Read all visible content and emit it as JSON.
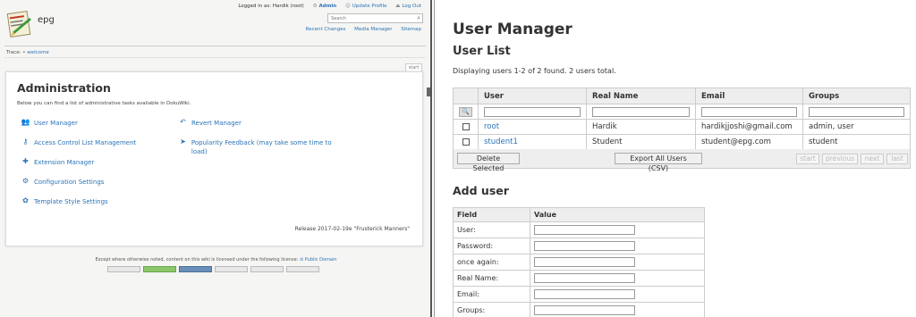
{
  "left": {
    "site_title": "epg",
    "user_line": {
      "logged_in": "Logged in as: Hardik (root)",
      "admin": "Admin",
      "update_profile": "Update Profile",
      "log_out": "Log Out"
    },
    "search_placeholder": "Search",
    "tools": {
      "recent_changes": "Recent Changes",
      "media_manager": "Media Manager",
      "sitemap": "Sitemap"
    },
    "trace_label": "Trace:",
    "trace_link": "welcome",
    "start_tab": "start",
    "admin": {
      "title": "Administration",
      "description": "Below you can find a list of administrative tasks available in DokuWiki.",
      "items_left": [
        {
          "label": "User Manager",
          "icon": "users-icon"
        },
        {
          "label": "Access Control List Management",
          "icon": "key-icon"
        },
        {
          "label": "Extension Manager",
          "icon": "puzzle-icon"
        },
        {
          "label": "Configuration Settings",
          "icon": "gear-icon"
        },
        {
          "label": "Template Style Settings",
          "icon": "palette-icon"
        }
      ],
      "items_right": [
        {
          "label": "Revert Manager",
          "icon": "revert-icon"
        },
        {
          "label": "Popularity Feedback (may take some time to load)",
          "icon": "send-icon"
        }
      ],
      "release": "Release 2017-02-19e \"Frusterick Manners\""
    },
    "license": {
      "text": "Except where otherwise noted, content on this wiki is licensed under the following license:",
      "link": "Public Domain"
    }
  },
  "right": {
    "title": "User Manager",
    "list_title": "User List",
    "displaying": "Displaying users 1-2 of 2 found. 2 users total.",
    "columns": [
      "User",
      "Real Name",
      "Email",
      "Groups"
    ],
    "rows": [
      {
        "user": "root",
        "real_name": "Hardik",
        "email": "hardikjjoshi@gmail.com",
        "groups": "admin, user"
      },
      {
        "user": "student1",
        "real_name": "Student",
        "email": "student@epg.com",
        "groups": "student"
      }
    ],
    "delete_selected": "Delete Selected",
    "export_all": "Export All Users (CSV)",
    "pager": {
      "start": "start",
      "previous": "previous",
      "next": "next",
      "last": "last"
    },
    "add_user_title": "Add user",
    "form_headers": {
      "field": "Field",
      "value": "Value"
    },
    "form_fields": [
      "User:",
      "Password:",
      "once again:",
      "Real Name:",
      "Email:",
      "Groups:"
    ]
  },
  "colors": {
    "link": "#2b73b7",
    "header_bg": "#eeeeee",
    "border": "#cccccc"
  }
}
